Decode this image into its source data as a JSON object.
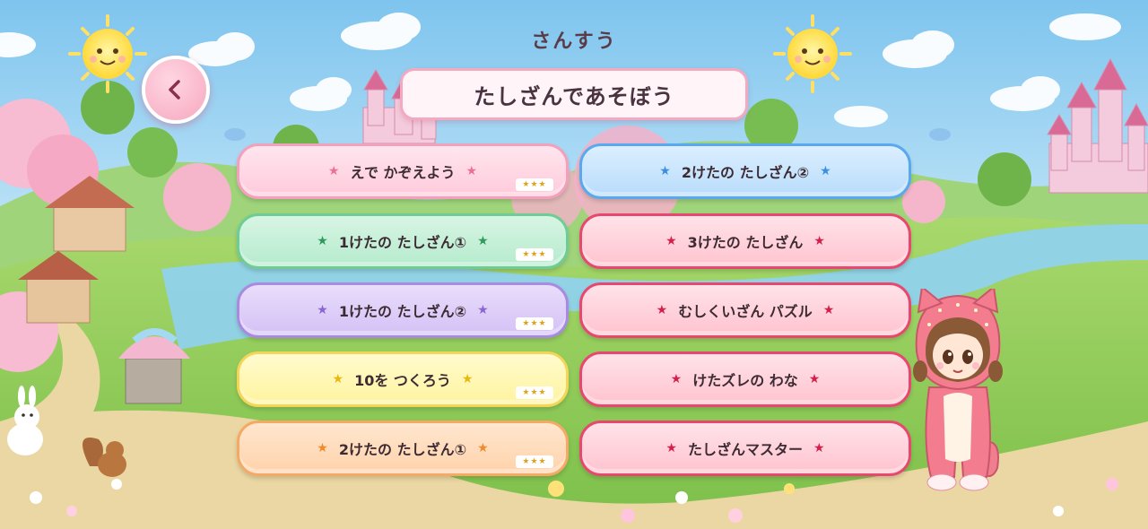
{
  "header": {
    "subject": "さんすう",
    "title": "たしざんであそぼう",
    "back_icon": "chevron-left-icon"
  },
  "colors": {
    "pink": "#f2a0bc",
    "green": "#6fcc95",
    "purple": "#a88be0",
    "yellow": "#f3d657",
    "orange": "#f6a964",
    "blue": "#5aa8ee",
    "rose": "#e8486f",
    "star_rating": "#e0a21a"
  },
  "lessons_left": [
    {
      "label": "えで かぞえよう",
      "rating": "★★★",
      "color": "pink"
    },
    {
      "label": "1けたの たしざん①",
      "rating": "★★★",
      "color": "green"
    },
    {
      "label": "1けたの たしざん②",
      "rating": "★★★",
      "color": "purple"
    },
    {
      "label": "10を つくろう",
      "rating": "★★★",
      "color": "yellow"
    },
    {
      "label": "2けたの たしざん①",
      "rating": "★★★",
      "color": "orange"
    }
  ],
  "lessons_right": [
    {
      "label": "2けたの たしざん②",
      "color": "blue"
    },
    {
      "label": "3けたの たしざん",
      "color": "rose"
    },
    {
      "label": "むしくいざん パズル",
      "color": "rose"
    },
    {
      "label": "けたズレの わな",
      "color": "rose"
    },
    {
      "label": "たしざんマスター",
      "color": "rose"
    }
  ],
  "star_glyph": "★"
}
